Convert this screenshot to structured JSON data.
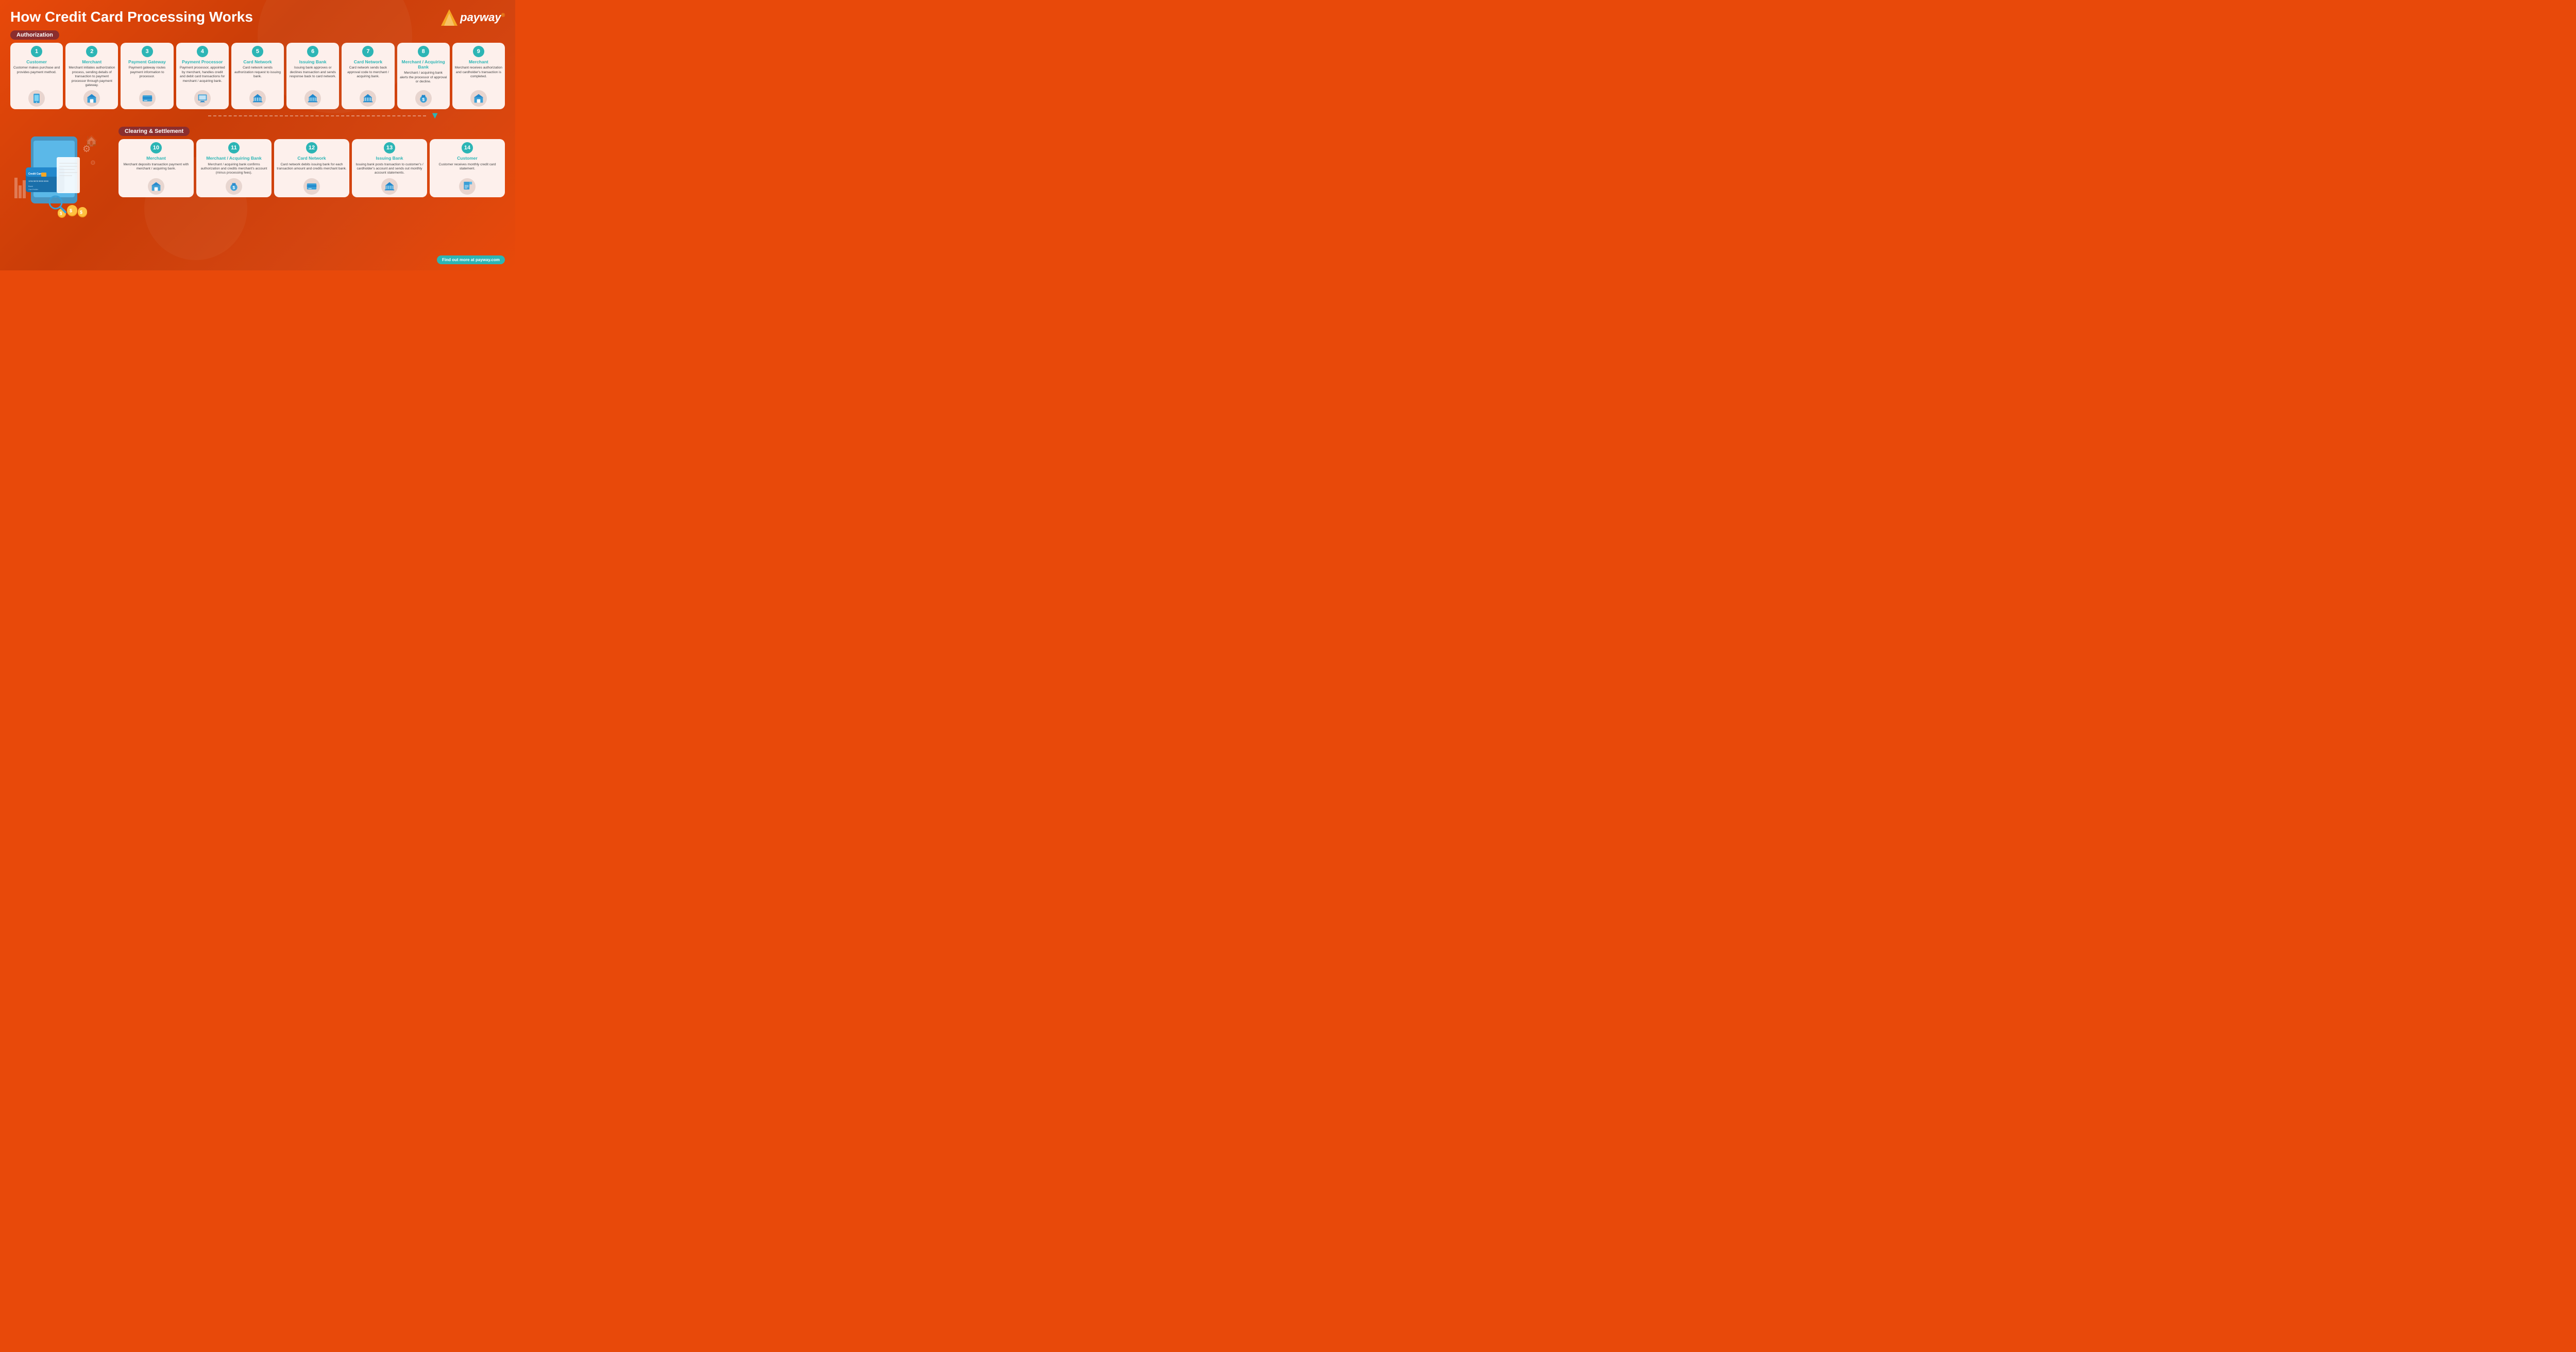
{
  "title": "How Credit Card Processing Works",
  "logo": {
    "text": "payway",
    "reg": "®"
  },
  "sections": {
    "authorization": {
      "label": "Authorization",
      "cards": [
        {
          "number": "1",
          "title": "Customer",
          "desc": "Customer makes purchase and provides payment method.",
          "icon": "📱"
        },
        {
          "number": "2",
          "title": "Merchant",
          "desc": "Merchant initiates authorization process, sending details of transaction to payment processor through payment gateway.",
          "icon": "🏪"
        },
        {
          "number": "3",
          "title": "Payment Gateway",
          "desc": "Payment gateway routes payment information to processor.",
          "icon": "💳"
        },
        {
          "number": "4",
          "title": "Payment Processor",
          "desc": "Payment processor, appointed by merchant, handles credit and debit card transactions for merchant / acquiring bank.",
          "icon": "🖥️"
        },
        {
          "number": "5",
          "title": "Card Network",
          "desc": "Card network sends authorization request to issuing bank.",
          "icon": "🏦"
        },
        {
          "number": "6",
          "title": "Issuing Bank",
          "desc": "Issuing bank approves or declines transaction and sends response back to card network.",
          "icon": "🏛️"
        },
        {
          "number": "7",
          "title": "Card Network",
          "desc": "Card network sends back approval code to merchant / acquiring bank.",
          "icon": "🏦"
        },
        {
          "number": "8",
          "title": "Merchant / Acquiring Bank",
          "desc": "Merchant / acquiring bank alerts the processor of approval or decline.",
          "icon": "💰"
        },
        {
          "number": "9",
          "title": "Merchant",
          "desc": "Merchant receives authorization and cardholder's transaction is completed.",
          "icon": "🏪"
        }
      ]
    },
    "clearing": {
      "label": "Clearing & Settlement",
      "cards": [
        {
          "number": "10",
          "title": "Merchant",
          "desc": "Merchant deposits transaction payment with merchant / acquiring bank.",
          "icon": "🏪"
        },
        {
          "number": "11",
          "title": "Merchant / Acquiring Bank",
          "desc": "Merchant / acquiring bank confirms authorization and credits merchant's account (minus processing fees).",
          "icon": "💰"
        },
        {
          "number": "12",
          "title": "Card Network",
          "desc": "Card network debits issuing bank for each transaction amount and credits merchant bank.",
          "icon": "💳"
        },
        {
          "number": "13",
          "title": "Issuing Bank",
          "desc": "Issuing bank posts transaction to customer's / cardholder's account and sends out monthly account statements.",
          "icon": "🏛️"
        },
        {
          "number": "14",
          "title": "Customer",
          "desc": "Customer receives monthly credit card statement.",
          "icon": "📄"
        }
      ]
    }
  },
  "footer": {
    "link": "Find out more at payway.com"
  }
}
